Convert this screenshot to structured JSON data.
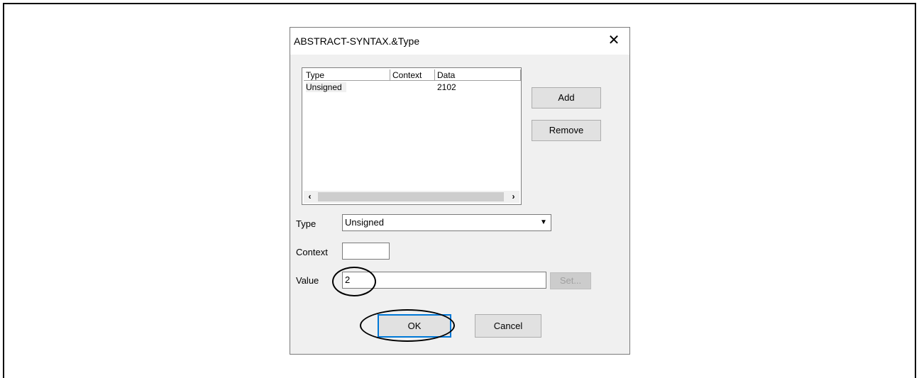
{
  "dialog": {
    "title": "ABSTRACT-SYNTAX.&Type",
    "close_glyph": "✕"
  },
  "list": {
    "columns": [
      "Type",
      "Context",
      "Data"
    ],
    "rows": [
      {
        "type": "Unsigned",
        "context": "",
        "data": "2102"
      }
    ],
    "scroll_left": "‹",
    "scroll_right": "›"
  },
  "buttons": {
    "add": "Add",
    "remove": "Remove",
    "set": "Set...",
    "ok": "OK",
    "cancel": "Cancel"
  },
  "form": {
    "type_label": "Type",
    "type_value": "Unsigned",
    "context_label": "Context",
    "context_value": "",
    "value_label": "Value",
    "value_value": "2"
  },
  "icons": {
    "dropdown": "▼"
  }
}
